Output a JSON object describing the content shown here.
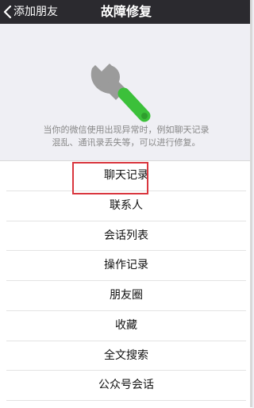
{
  "navbar": {
    "back_label": "添加朋友",
    "title": "故障修复"
  },
  "hero": {
    "description_line1": "当你的微信使用出现异常时，例如聊天记录",
    "description_line2": "混乱、通讯录丢失等，可以进行修复。"
  },
  "list": {
    "items": [
      {
        "label": "聊天记录"
      },
      {
        "label": "联系人"
      },
      {
        "label": "会话列表"
      },
      {
        "label": "操作记录"
      },
      {
        "label": "朋友圈"
      },
      {
        "label": "收藏"
      },
      {
        "label": "全文搜索"
      },
      {
        "label": "公众号会话"
      }
    ]
  },
  "colors": {
    "navbar_bg": "#2b2a2f",
    "wrench_head": "#9b9b9b",
    "wrench_handle": "#3cc03a",
    "highlight_border": "#d9363e"
  },
  "icons": {
    "back": "chevron-left-icon",
    "hero": "wrench-icon"
  }
}
